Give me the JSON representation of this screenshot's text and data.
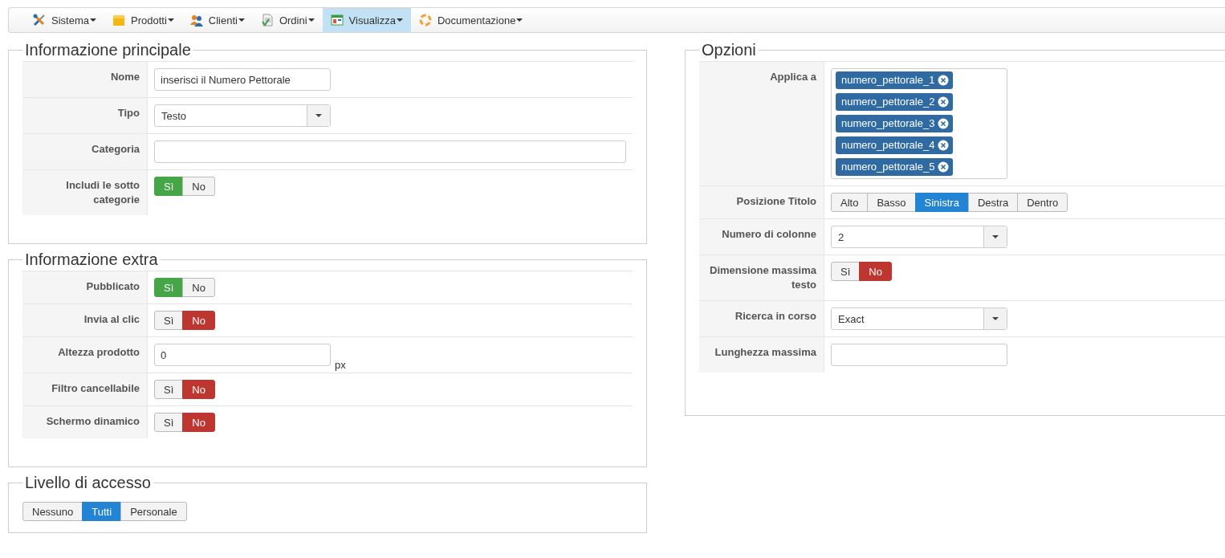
{
  "menu": [
    {
      "label": "Sistema",
      "selected": false
    },
    {
      "label": "Prodotti",
      "selected": false
    },
    {
      "label": "Clienti",
      "selected": false
    },
    {
      "label": "Ordini",
      "selected": false
    },
    {
      "label": "Visualizza",
      "selected": true
    },
    {
      "label": "Documentazione",
      "selected": false
    }
  ],
  "left_panels": [
    {
      "title": "Informazione principale",
      "rows": [
        {
          "label": "Nome",
          "kind": "text",
          "value": "inserisci il Numero Pettorale"
        },
        {
          "label": "Tipo",
          "kind": "select",
          "value": "Testo"
        },
        {
          "label": "Categoria",
          "kind": "text",
          "wide": true
        },
        {
          "label": "Includi le sotto categorie",
          "kind": "toggle",
          "options": [
            {
              "label": "Sì",
              "selected": true,
              "kind": "yes"
            },
            {
              "label": "No",
              "selected": false,
              "kind": "no"
            }
          ]
        }
      ]
    },
    {
      "title": "Informazione extra",
      "rows": [
        {
          "label": "Pubblicato",
          "kind": "toggle",
          "options": [
            {
              "label": "Sì",
              "selected": true,
              "kind": "yes"
            },
            {
              "label": "No",
              "selected": false,
              "kind": "no"
            }
          ]
        },
        {
          "label": "Invia al clic",
          "kind": "toggle",
          "options": [
            {
              "label": "Sì",
              "selected": false,
              "kind": "yes"
            },
            {
              "label": "No",
              "selected": true,
              "kind": "no"
            }
          ]
        },
        {
          "label": "Altezza prodotto",
          "kind": "text",
          "value": "0",
          "suffix": "px"
        },
        {
          "label": "Filtro cancellabile",
          "kind": "toggle",
          "options": [
            {
              "label": "Sì",
              "selected": false,
              "kind": "yes"
            },
            {
              "label": "No",
              "selected": true,
              "kind": "no"
            }
          ]
        },
        {
          "label": "Schermo dinamico",
          "kind": "toggle",
          "options": [
            {
              "label": "Sì",
              "selected": false,
              "kind": "yes"
            },
            {
              "label": "No",
              "selected": true,
              "kind": "no"
            }
          ]
        }
      ]
    },
    {
      "title": "Livello di accesso",
      "options": [
        {
          "label": "Nessuno",
          "selected": false,
          "kind": "choice"
        },
        {
          "label": "Tutti",
          "selected": true,
          "kind": "choice"
        },
        {
          "label": "Personale",
          "selected": false,
          "kind": "choice"
        }
      ]
    }
  ],
  "right_panels": [
    {
      "title": "Opzioni",
      "rows": [
        {
          "label": "Applica a",
          "kind": "tags",
          "tags": [
            "numero_pettorale_1",
            "numero_pettorale_2",
            "numero_pettorale_3",
            "numero_pettorale_4",
            "numero_pettorale_5"
          ]
        },
        {
          "label": "Posizione Titolo",
          "kind": "toggle",
          "options": [
            {
              "label": "Alto",
              "selected": false,
              "kind": "choice"
            },
            {
              "label": "Basso",
              "selected": false,
              "kind": "choice"
            },
            {
              "label": "Sinistra",
              "selected": true,
              "kind": "choice"
            },
            {
              "label": "Destra",
              "selected": false,
              "kind": "choice"
            },
            {
              "label": "Dentro",
              "selected": false,
              "kind": "choice"
            }
          ]
        },
        {
          "label": "Numero di colonne",
          "kind": "select",
          "value": "2"
        },
        {
          "label": "Dimensione massima testo",
          "kind": "toggle",
          "options": [
            {
              "label": "Sì",
              "selected": false,
              "kind": "yes"
            },
            {
              "label": "No",
              "selected": true,
              "kind": "no"
            }
          ]
        },
        {
          "label": "Ricerca in corso",
          "kind": "select",
          "value": "Exact"
        },
        {
          "label": "Lunghezza massima",
          "kind": "text"
        }
      ]
    }
  ]
}
